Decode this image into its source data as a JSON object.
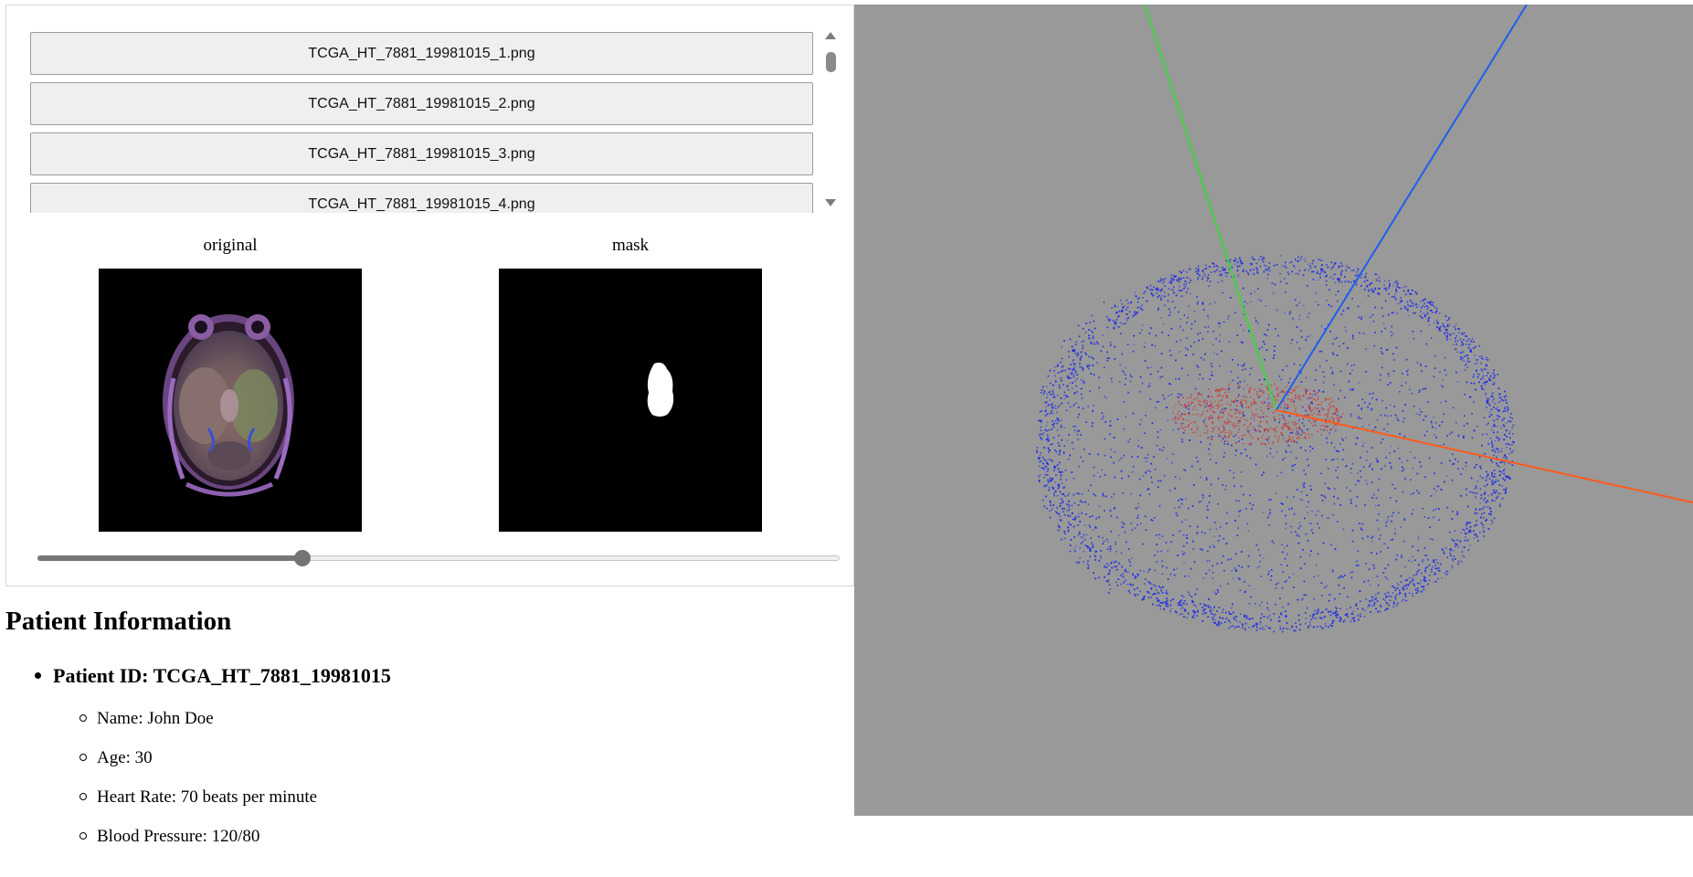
{
  "files": [
    "TCGA_HT_7881_19981015_1.png",
    "TCGA_HT_7881_19981015_2.png",
    "TCGA_HT_7881_19981015_3.png",
    "TCGA_HT_7881_19981015_4.png"
  ],
  "images": {
    "original_label": "original",
    "mask_label": "mask"
  },
  "slider": {
    "value": 0.33
  },
  "patient": {
    "title": "Patient Information",
    "id_line": "Patient ID: TCGA_HT_7881_19981015",
    "details": [
      "Name: John Doe",
      "Age: 30",
      "Heart Rate: 70 beats per minute",
      "Blood Pressure: 120/80"
    ]
  },
  "colors": {
    "viewport_bg": "#999999",
    "point_cloud": "#1f2ee6",
    "tumor_points": "#d4302a",
    "axis_x": "#ff5a1a",
    "axis_y": "#3cd63c",
    "axis_z": "#1f5ef0"
  }
}
